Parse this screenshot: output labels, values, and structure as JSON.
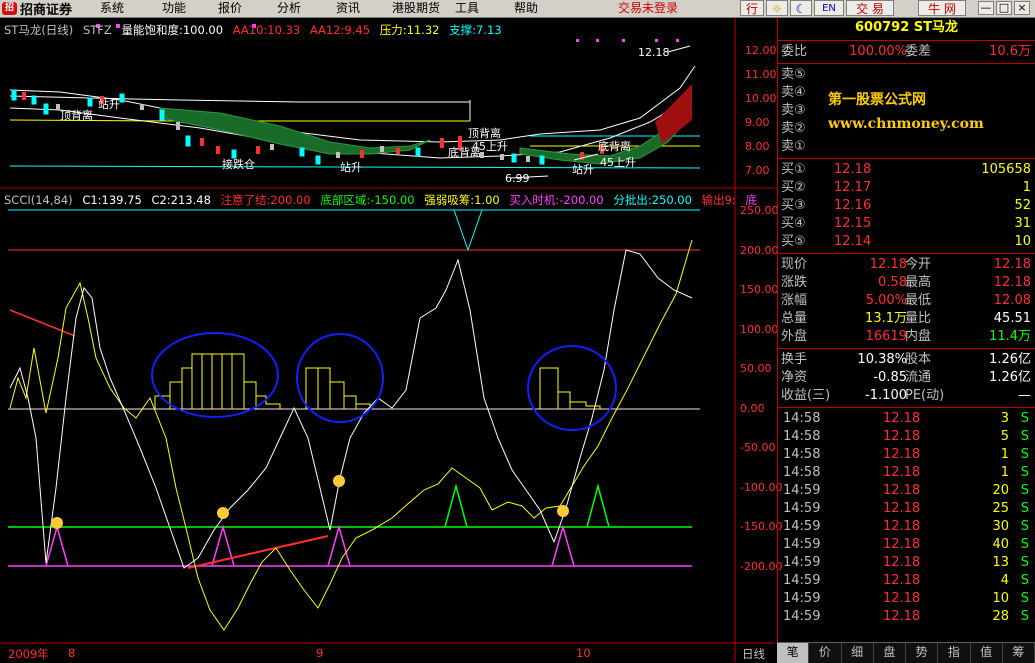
{
  "menubar": {
    "app_name": "招商证券",
    "logo_mark": "招",
    "menu_items": [
      "系统",
      "功能",
      "报价",
      "分析",
      "资讯",
      "港股期货",
      "工具",
      "帮助"
    ],
    "trade_status": "交易未登录",
    "right_buttons": {
      "market": "行",
      "trade": "交 易",
      "bull": "牛 网"
    },
    "window_buttons": [
      "—",
      "□",
      "×"
    ]
  },
  "main_chart": {
    "title": "ST马龙(日线)",
    "code": "STFZ",
    "indicators": [
      {
        "text": "量能饱和度:100.00",
        "color": "#ffffff"
      },
      {
        "text": "AA10:10.33",
        "color": "#ff3030"
      },
      {
        "text": "AA12:9.45",
        "color": "#ff3030"
      },
      {
        "text": "压力:11.32",
        "color": "#ffff00"
      },
      {
        "text": "支撑:7.13",
        "color": "#00ffff"
      }
    ],
    "y_ticks": [
      "12.00",
      "11.00",
      "10.00",
      "9.00",
      "8.00",
      "7.00"
    ],
    "annotations": {
      "high_label": "12.18",
      "low_label": "6.99",
      "top_divergence": "顶背离",
      "bottom_divergence": "底背离",
      "bottom_divergence2": "底背离",
      "rise45a": "45上升",
      "rise45b": "45上升",
      "stand": "站升",
      "stand2": "站升",
      "stand3": "站升",
      "jump": "接跌仓",
      "left_div": "顶背离"
    }
  },
  "scci_chart": {
    "indicators": [
      {
        "text": "SCCI(14,84)",
        "color": "#c0c0c0"
      },
      {
        "text": "C1:139.75",
        "color": "#ffffff"
      },
      {
        "text": "C2:213.48",
        "color": "#ffffff"
      },
      {
        "text": "注意了结:200.00",
        "color": "#ff3030"
      },
      {
        "text": "底部区域:-150.00",
        "color": "#00ff00"
      },
      {
        "text": "强弱吸筹:1.00",
        "color": "#ffff00"
      },
      {
        "text": "买入时机:-200.00",
        "color": "#ff40ff"
      },
      {
        "text": "分批出:250.00",
        "color": "#00ffff"
      },
      {
        "text": "输出9:",
        "color": "#ff3030"
      },
      {
        "text": "底",
        "color": "#ff40ff"
      }
    ],
    "y_ticks": [
      "250.00",
      "200.00",
      "150.00",
      "100.00",
      "50.00",
      "0.00",
      "-50.00",
      "-100.00",
      "-150.00",
      "-200.00"
    ]
  },
  "x_axis": {
    "year": "2009年",
    "m8": "8",
    "m9": "9",
    "m10": "10",
    "period": "日线"
  },
  "quote": {
    "header": "600792 ST马龙",
    "weibi": {
      "label": "委比",
      "value": "100.00%",
      "label2": "委差",
      "value2": "10.6万"
    },
    "sell": [
      {
        "label": "卖⑤",
        "price": "",
        "vol": ""
      },
      {
        "label": "卖④",
        "price": "",
        "vol": ""
      },
      {
        "label": "卖③",
        "price": "",
        "vol": ""
      },
      {
        "label": "卖②",
        "price": "",
        "vol": ""
      },
      {
        "label": "卖①",
        "price": "",
        "vol": ""
      }
    ],
    "buy": [
      {
        "label": "买①",
        "price": "12.18",
        "vol": "105658"
      },
      {
        "label": "买②",
        "price": "12.17",
        "vol": "1"
      },
      {
        "label": "买③",
        "price": "12.16",
        "vol": "52"
      },
      {
        "label": "买④",
        "price": "12.15",
        "vol": "31"
      },
      {
        "label": "买⑤",
        "price": "12.14",
        "vol": "10"
      }
    ],
    "stats": [
      {
        "l1": "现价",
        "v1": "12.18",
        "c1": "#ff3030",
        "l2": "今开",
        "v2": "12.18",
        "c2": "#ff3030"
      },
      {
        "l1": "涨跌",
        "v1": "0.58",
        "c1": "#ff3030",
        "l2": "最高",
        "v2": "12.18",
        "c2": "#ff3030"
      },
      {
        "l1": "涨幅",
        "v1": "5.00%",
        "c1": "#ff3030",
        "l2": "最低",
        "v2": "12.08",
        "c2": "#ff3030"
      },
      {
        "l1": "总量",
        "v1": "13.1万",
        "c1": "#ffff00",
        "l2": "量比",
        "v2": "45.51",
        "c2": "#ffffff"
      },
      {
        "l1": "外盘",
        "v1": "16619",
        "c1": "#ff3030",
        "l2": "内盘",
        "v2": "11.4万",
        "c2": "#00ff00"
      }
    ],
    "stats2": [
      {
        "l1": "换手",
        "v1": "10.38%",
        "c1": "#ffffff",
        "l2": "股本",
        "v2": "1.26亿",
        "c2": "#ffffff"
      },
      {
        "l1": "净资",
        "v1": "-0.85",
        "c1": "#ffffff",
        "l2": "流通",
        "v2": "1.26亿",
        "c2": "#ffffff"
      },
      {
        "l1": "收益(三)",
        "v1": "-1.100",
        "c1": "#ffffff",
        "l2": "PE(动)",
        "v2": "—",
        "c2": "#ffffff"
      }
    ],
    "ticks": [
      {
        "time": "14:58",
        "price": "12.18",
        "vol": "3",
        "side": "S"
      },
      {
        "time": "14:58",
        "price": "12.18",
        "vol": "5",
        "side": "S"
      },
      {
        "time": "14:58",
        "price": "12.18",
        "vol": "1",
        "side": "S"
      },
      {
        "time": "14:58",
        "price": "12.18",
        "vol": "1",
        "side": "S"
      },
      {
        "time": "14:59",
        "price": "12.18",
        "vol": "20",
        "side": "S"
      },
      {
        "time": "14:59",
        "price": "12.18",
        "vol": "25",
        "side": "S"
      },
      {
        "time": "14:59",
        "price": "12.18",
        "vol": "30",
        "side": "S"
      },
      {
        "time": "14:59",
        "price": "12.18",
        "vol": "40",
        "side": "S"
      },
      {
        "time": "14:59",
        "price": "12.18",
        "vol": "13",
        "side": "S"
      },
      {
        "time": "14:59",
        "price": "12.18",
        "vol": "4",
        "side": "S"
      },
      {
        "time": "14:59",
        "price": "12.18",
        "vol": "10",
        "side": "S"
      },
      {
        "time": "14:59",
        "price": "12.18",
        "vol": "28",
        "side": "S"
      }
    ],
    "tabs": [
      "笔",
      "价",
      "细",
      "盘",
      "势",
      "指",
      "值",
      "筹"
    ]
  },
  "watermark": {
    "cn": "第一股票公式网",
    "en": "www.chnmoney.com"
  }
}
